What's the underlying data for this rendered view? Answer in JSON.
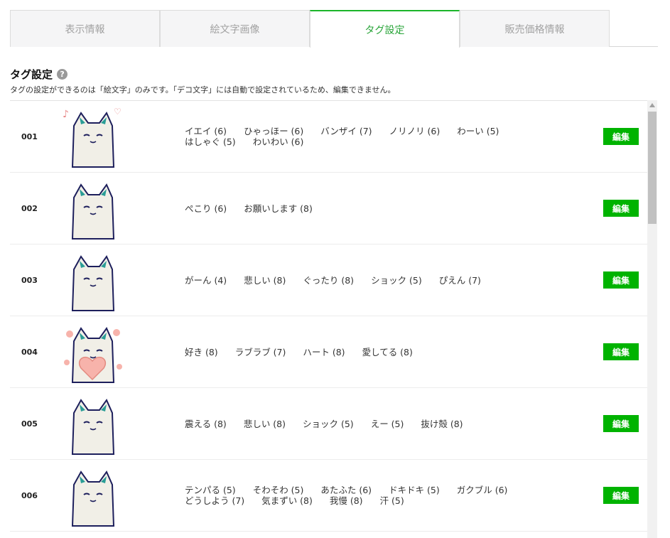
{
  "tabs": [
    {
      "label": "表示情報",
      "active": false
    },
    {
      "label": "絵文字画像",
      "active": false
    },
    {
      "label": "タグ設定",
      "active": true
    },
    {
      "label": "販売価格情報",
      "active": false
    }
  ],
  "section": {
    "title": "タグ設定",
    "help": "?",
    "description": "タグの設定ができるのは「絵文字」のみです。「デコ文字」には自動で設定されているため、編集できません。"
  },
  "edit_label": "編集",
  "colors": {
    "accent": "#00b300",
    "active_tab": "#1bb52a"
  },
  "rows": [
    {
      "num": "001",
      "tags": [
        "イエイ (6)",
        "ひゃっほー (6)",
        "バンザイ (7)",
        "ノリノリ (6)",
        "わーい (5)",
        "はしゃぐ (5)",
        "わいわい (6)"
      ]
    },
    {
      "num": "002",
      "tags": [
        "ぺこり (6)",
        "お願いします (8)"
      ]
    },
    {
      "num": "003",
      "tags": [
        "がーん (4)",
        "悲しい (8)",
        "ぐったり (8)",
        "ショック (5)",
        "ぴえん (7)"
      ]
    },
    {
      "num": "004",
      "tags": [
        "好き (8)",
        "ラブラブ (7)",
        "ハート (8)",
        "愛してる (8)"
      ]
    },
    {
      "num": "005",
      "tags": [
        "震える (8)",
        "悲しい (8)",
        "ショック (5)",
        "えー (5)",
        "抜け殻 (8)"
      ]
    },
    {
      "num": "006",
      "tags": [
        "テンパる (5)",
        "そわそわ (5)",
        "あたふた (6)",
        "ドキドキ (5)",
        "ガクブル (6)",
        "どうしよう (7)",
        "気まずい (8)",
        "我慢 (8)",
        "汗 (5)"
      ]
    }
  ]
}
